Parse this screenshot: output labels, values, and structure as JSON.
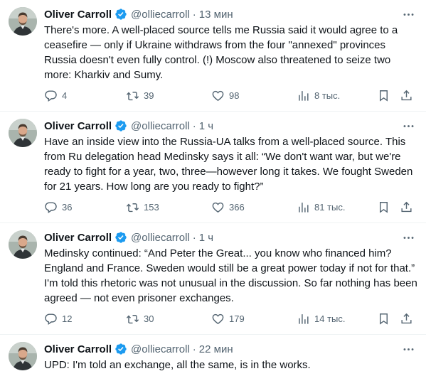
{
  "tweets": [
    {
      "name": "Oliver Carroll",
      "handle": "@olliecarroll",
      "dot": "·",
      "time": "13 мин",
      "text": "There's more. A well-placed source tells me Russia said it would agree to a ceasefire — only if Ukraine withdraws from the four \"annexed\" provinces Russia doesn't even fully control. (!) Moscow also threatened to seize two more: Kharkiv and Sumy.",
      "replies": "4",
      "retweets": "39",
      "likes": "98",
      "views": "8 тыс."
    },
    {
      "name": "Oliver Carroll",
      "handle": "@olliecarroll",
      "dot": "·",
      "time": "1 ч",
      "text": "Have an inside view into the Russia-UA talks from a well-placed source. This from Ru delegation head Medinsky says it all: “We don't want war, but we're ready to fight for a year, two, three—however long it takes. We fought Sweden for 21 years. How long are you ready to fight?”",
      "replies": "36",
      "retweets": "153",
      "likes": "366",
      "views": "81 тыс."
    },
    {
      "name": "Oliver Carroll",
      "handle": "@olliecarroll",
      "dot": "·",
      "time": "1 ч",
      "text": "Medinsky continued: “And Peter the Great... you know who financed him? England and France. Sweden would still be a great power today if not for that.” I'm told this rhetoric was not unusual in the discussion. So far nothing has been agreed — not even prisoner exchanges.",
      "replies": "12",
      "retweets": "30",
      "likes": "179",
      "views": "14 тыс."
    },
    {
      "name": "Oliver Carroll",
      "handle": "@olliecarroll",
      "dot": "·",
      "time": "22 мин",
      "text": "UPD: I'm told an exchange, all the same, is in the works."
    }
  ],
  "colors": {
    "text": "#0f1419",
    "muted": "#536471",
    "verified": "#1d9bf0",
    "divider": "#eff3f4"
  }
}
